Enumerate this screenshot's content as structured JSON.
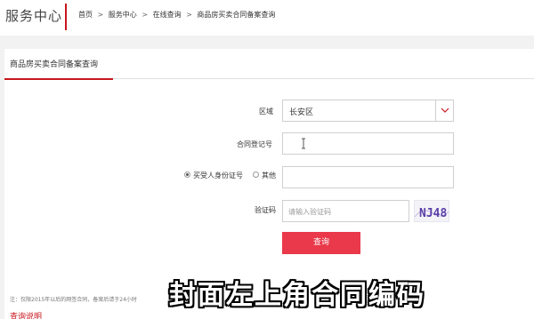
{
  "header": {
    "brand": "服务中心",
    "breadcrumb": {
      "home": "首页",
      "service_center": "服务中心",
      "online_query": "在线查询",
      "current": "商品房买卖合同备案查询",
      "separator": ">"
    }
  },
  "tabs": {
    "active_label": "商品房买卖合同备案查询"
  },
  "form": {
    "district_label": "区域",
    "district_value": "长安区",
    "contract_no_label": "合同登记号",
    "contract_no_value": "",
    "id_type": {
      "option_buyer_id": "买受人身份证号",
      "option_other": "其他",
      "selected": "买受人身份证号"
    },
    "id_value": "",
    "captcha_label": "验证码",
    "captcha_placeholder": "请输入验证码",
    "captcha_text": "NJ48",
    "submit_label": "查询"
  },
  "note": "注：仅限2015年以后的网签合同，备案后请于24小时",
  "bottom_tab_label": "查询说明",
  "subtitle": "封面左上角合同编码",
  "colors": {
    "accent": "#c8161d",
    "button": "#e9394a",
    "background": "#f2f2f2"
  }
}
